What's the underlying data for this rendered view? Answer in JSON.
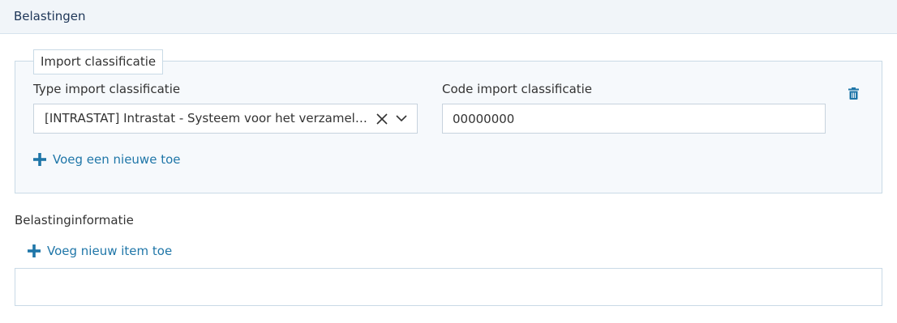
{
  "header": {
    "title": "Belastingen"
  },
  "import_section": {
    "legend": "Import classificatie",
    "type_label": "Type import classificatie",
    "type_value": "[INTRASTAT] Intrastat - Systeem voor het verzamelen van statistieken over de handel in goederen",
    "code_label": "Code import classificatie",
    "code_value": "00000000",
    "add_label": "Voeg een nieuwe toe"
  },
  "tax_info": {
    "title": "Belastinginformatie",
    "add_label": "Voeg nieuw item toe"
  },
  "colors": {
    "accent": "#1f76a8",
    "header_bg": "#f1f5f9",
    "header_text": "#1d3557",
    "border": "#c9dae6"
  },
  "icons": [
    "trash-icon",
    "clear-icon",
    "chevron-down-icon",
    "plus-icon"
  ]
}
